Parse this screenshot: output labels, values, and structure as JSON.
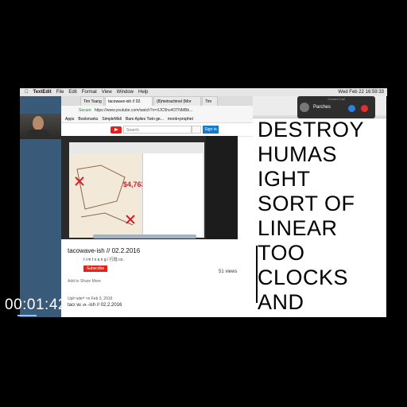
{
  "menubar": {
    "app": "TextEdit",
    "items": [
      "File",
      "Edit",
      "Format",
      "View",
      "Window",
      "Help"
    ],
    "clock": "Wed Feb 22  16:59:33"
  },
  "browser": {
    "tabs": [
      "Tim Tsang",
      "tacowave-ish // 02.",
      "(8)metrachinel (Mor",
      "Tim"
    ],
    "url_secure": "Secure",
    "url": "https://www.youtube.com/watch?v=XJC5hs4OTNMBb...",
    "bookmarks": [
      "Apps",
      "Bookmarks",
      "SimpleMidi",
      "Bare Aplies Twin ge...",
      "monk+prophet"
    ],
    "search_placeholder": "Search",
    "signin_label": "Sign in"
  },
  "video": {
    "money_text": "$4,763,404.54",
    "title": "tacowave-ish // 02.2.2016",
    "channel": "t i m t s a n g / 行陆 co.",
    "subscribe_label": "Subscribe",
    "views": "51 views",
    "actions": "Add to   Share   More",
    "published": "Uploaded on Feb 3, 2016",
    "description": "tacowave-ish // 02.2.2016"
  },
  "textedit": {
    "lines": [
      "DESTROY",
      "HUMAS",
      "IGHT",
      "SORT OF",
      "LINEAR",
      "TOO",
      "CLOCKS",
      "AND"
    ]
  },
  "call": {
    "title": "Current Call",
    "caller": "Parches"
  },
  "overlay": {
    "timecode": "00:01:42;16"
  },
  "colors": {
    "youtube_red": "#e62117",
    "signin_blue": "#167ac6",
    "accept": "#2f7fe0",
    "decline": "#e0312a"
  }
}
